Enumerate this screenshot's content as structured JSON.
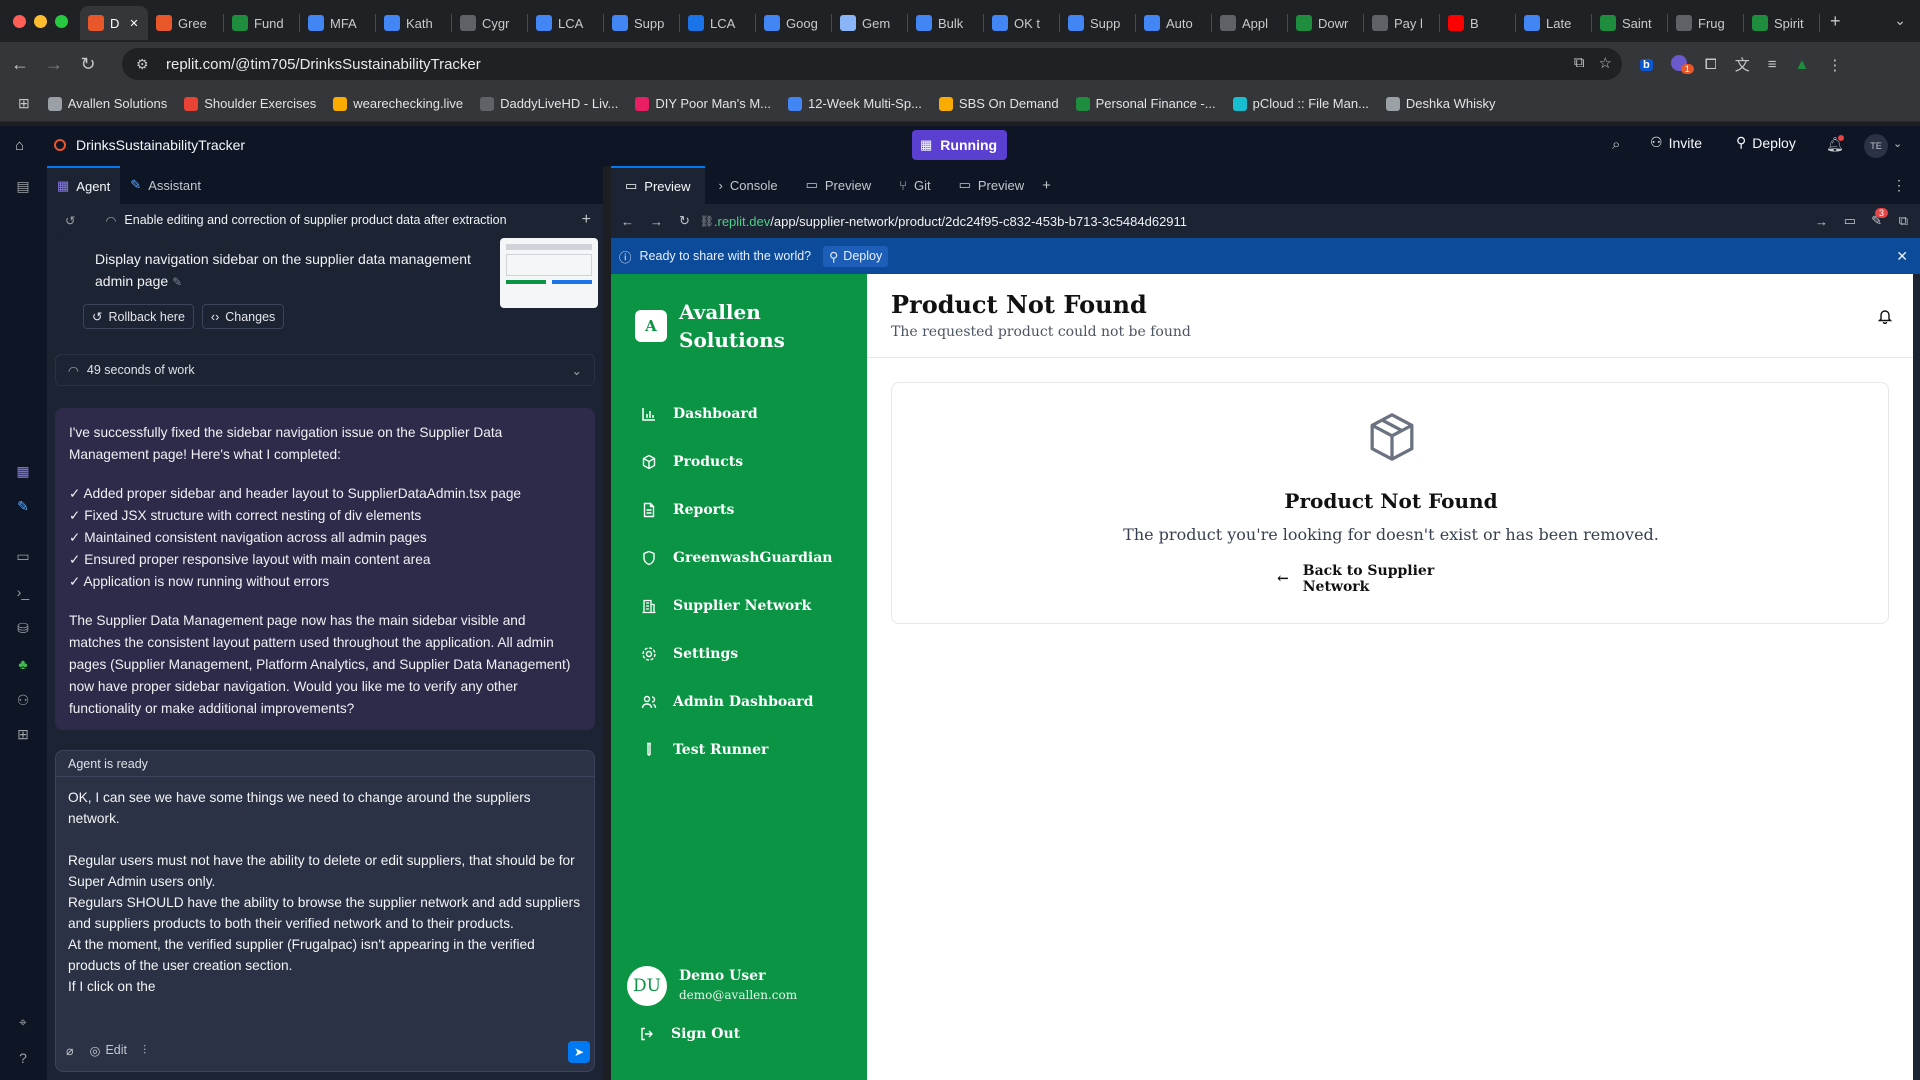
{
  "browser": {
    "tabs": [
      {
        "label": "D",
        "color": "#e8572a",
        "active": true
      },
      {
        "label": "Gree",
        "color": "#e8572a"
      },
      {
        "label": "Fund",
        "color": "#1e8e3e"
      },
      {
        "label": "MFA",
        "color": "#4285f4"
      },
      {
        "label": "Kath",
        "color": "#4285f4"
      },
      {
        "label": "Cygr",
        "color": "#5f6368"
      },
      {
        "label": "LCA",
        "color": "#4285f4"
      },
      {
        "label": "Supp",
        "color": "#4285f4"
      },
      {
        "label": "LCA",
        "color": "#1a73e8"
      },
      {
        "label": "Goog",
        "color": "#4285f4"
      },
      {
        "label": "Gem",
        "color": "#8ab4f8"
      },
      {
        "label": "Bulk",
        "color": "#4285f4"
      },
      {
        "label": "OK t",
        "color": "#4285f4"
      },
      {
        "label": "Supp",
        "color": "#4285f4"
      },
      {
        "label": "Auto",
        "color": "#4285f4"
      },
      {
        "label": "Appl",
        "color": "#5f6368"
      },
      {
        "label": "Dowr",
        "color": "#1e8e3e"
      },
      {
        "label": "Pay l",
        "color": "#5f6368"
      },
      {
        "label": "B",
        "color": "#ff0000"
      },
      {
        "label": "Late",
        "color": "#4285f4"
      },
      {
        "label": "Saint",
        "color": "#1e8e3e"
      },
      {
        "label": "Frug",
        "color": "#5f6368"
      },
      {
        "label": "Spirit",
        "color": "#1e8e3e"
      }
    ],
    "url": "replit.com/@tim705/DrinksSustainabilityTracker",
    "bookmarks": [
      {
        "label": "Avallen Solutions",
        "color": "#9aa0a6"
      },
      {
        "label": "Shoulder Exercises",
        "color": "#ea4335"
      },
      {
        "label": "wearechecking.live",
        "color": "#f9ab00"
      },
      {
        "label": "DaddyLiveHD - Liv...",
        "color": "#5f6368"
      },
      {
        "label": "DIY Poor Man's M...",
        "color": "#e91e63"
      },
      {
        "label": "12-Week Multi-Sp...",
        "color": "#4285f4"
      },
      {
        "label": "SBS On Demand",
        "color": "#f9ab00"
      },
      {
        "label": "Personal Finance -...",
        "color": "#1e8e3e"
      },
      {
        "label": "pCloud :: File Man...",
        "color": "#17bed0"
      },
      {
        "label": "Deshka Whisky",
        "color": "#9aa0a6"
      }
    ]
  },
  "replit": {
    "project_name": "DrinksSustainabilityTracker",
    "run_status": "Running",
    "invite_label": "Invite",
    "deploy_label": "Deploy",
    "avatar_initials": "TE",
    "agent_tabs": [
      "Agent",
      "Assistant"
    ],
    "task_title": "Enable editing and correction of supplier product data after extraction",
    "checkpoint_text": "Display navigation sidebar on the supplier data management admin page",
    "rollback_label": "Rollback here",
    "changes_label": "Changes",
    "work_summary": "49 seconds of work",
    "agent_message": {
      "intro": "I've successfully fixed the sidebar navigation issue on the Supplier Data Management page! Here's what I completed:",
      "items": [
        "✓ Added proper sidebar and header layout to SupplierDataAdmin.tsx page",
        "✓ Fixed JSX structure with correct nesting of div elements",
        "✓ Maintained consistent navigation across all admin pages",
        "✓ Ensured proper responsive layout with main content area",
        "✓ Application is now running without errors"
      ],
      "outro": "The Supplier Data Management page now has the main sidebar visible and matches the consistent layout pattern used throughout the application. All admin pages (Supplier Management, Platform Analytics, and Supplier Data Management) now have proper sidebar navigation. Would you like me to verify any other functionality or make additional improvements?"
    },
    "composer": {
      "status": "Agent is ready",
      "text": "OK, I can see we have some things we need to change around the suppliers network.\n\nRegular users must not have the ability to delete or edit suppliers, that should be for Super Admin users only.\nRegulars SHOULD have the ability to browse the supplier network and add suppliers and suppliers products to both their verified network and to their products.\nAt the moment, the verified supplier (Frugalpac) isn't appearing in the verified products of the user creation section.\nIf I click on the",
      "edit_label": "Edit"
    },
    "right_tabs": [
      "Preview",
      "Console",
      "Preview",
      "Git",
      "Preview"
    ],
    "preview_url_domain": ".replit.dev",
    "preview_url_path": "/app/supplier-network/product/2dc24f95-c832-453b-b713-3c5484d62911",
    "notif_count": "3",
    "banner_text": "Ready to share with the world?",
    "banner_deploy": "Deploy",
    "ext_badge": "1"
  },
  "app": {
    "logo_letter": "A",
    "brand_line1": "Avallen",
    "brand_line2": "Solutions",
    "nav": [
      {
        "label": "Dashboard",
        "icon": "bar-chart-icon"
      },
      {
        "label": "Products",
        "icon": "package-icon"
      },
      {
        "label": "Reports",
        "icon": "file-text-icon"
      },
      {
        "label": "GreenwashGuardian",
        "icon": "shield-icon"
      },
      {
        "label": "Supplier Network",
        "icon": "building-icon"
      },
      {
        "label": "Settings",
        "icon": "settings-icon"
      },
      {
        "label": "Admin Dashboard",
        "icon": "users-icon"
      },
      {
        "label": "Test Runner",
        "icon": "test-tube-icon"
      }
    ],
    "user": {
      "initials": "DU",
      "name": "Demo User",
      "email": "demo@avallen.com"
    },
    "sign_out": "Sign Out",
    "header_title": "Product Not Found",
    "header_subtitle": "The requested product could not be found",
    "card_title": "Product Not Found",
    "card_text": "The product you're looking for doesn't exist or has been removed.",
    "back_label": "Back to Supplier Network",
    "colors": {
      "sidebar": "#0a9444",
      "replit_bg": "#1c2333",
      "accent": "#0079f2",
      "run_purple": "#5b3fd1"
    }
  }
}
